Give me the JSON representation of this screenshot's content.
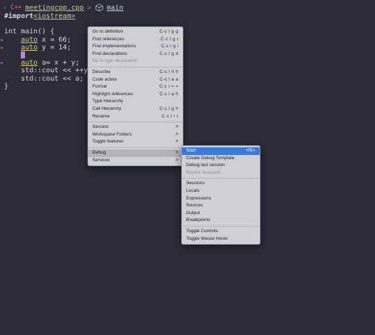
{
  "breadcrumb": {
    "file_label": "meetingcpp.cpp",
    "symbol_label": "main"
  },
  "code": {
    "line1_directive": "#import",
    "line1_header": "<iostream>",
    "line3": "int main() {",
    "line4_kw": "auto",
    "line4_rest": " x = 66;",
    "line5_kw": "auto",
    "line5_rest": " y = 14;",
    "line7_kw": "auto",
    "line7_rest": " a= x + y;",
    "line8": "std::cout << ++y +",
    "line9": "std::cout << a;",
    "line10": "}"
  },
  "context_menu": {
    "items": [
      {
        "label": "Go to definition",
        "shortcut": "C-c l g g"
      },
      {
        "label": "Find references",
        "shortcut": "C-c l g r"
      },
      {
        "label": "Find implementations",
        "shortcut": "C-c l g i"
      },
      {
        "label": "Find declarations",
        "shortcut": "C-c l g d"
      },
      {
        "label": "Go to type declaration",
        "shortcut": ""
      },
      {
        "label": "Describe",
        "shortcut": "C-c l h h"
      },
      {
        "label": "Code action",
        "shortcut": "C-c l a a"
      },
      {
        "label": "Format",
        "shortcut": "C-c l = ="
      },
      {
        "label": "Highlight references",
        "shortcut": "C-c l a h"
      },
      {
        "label": "Type Hierarchy",
        "shortcut": ""
      },
      {
        "label": "Call Hierarchy",
        "shortcut": "C-c l g h"
      },
      {
        "label": "Rename",
        "shortcut": "C-c l r r"
      },
      {
        "label": "Session",
        "shortcut": ">"
      },
      {
        "label": "Workspace Folders",
        "shortcut": ">"
      },
      {
        "label": "Toggle features",
        "shortcut": ">"
      },
      {
        "label": "Debug",
        "shortcut": ">"
      },
      {
        "label": "Services",
        "shortcut": ">"
      }
    ]
  },
  "debug_submenu": {
    "items": [
      {
        "label": "Start",
        "shortcut": "<f5>"
      },
      {
        "label": "Create Debug Template",
        "shortcut": ""
      },
      {
        "label": "Debug last session",
        "shortcut": ""
      },
      {
        "label": "Recent Sessions",
        "shortcut": ""
      },
      {
        "label": "Sessions",
        "shortcut": ""
      },
      {
        "label": "Locals",
        "shortcut": ""
      },
      {
        "label": "Expressions",
        "shortcut": ""
      },
      {
        "label": "Sources",
        "shortcut": ""
      },
      {
        "label": "Output",
        "shortcut": ""
      },
      {
        "label": "Breakpoints",
        "shortcut": ""
      },
      {
        "label": "Toggle Controls",
        "shortcut": ""
      },
      {
        "label": "Toggle Mouse Hover",
        "shortcut": ""
      }
    ]
  },
  "colors": {
    "background": "#2b2c38",
    "menu_background": "#cfd0d4",
    "active_item": "#3b78d8",
    "keyword": "#d6d07a"
  }
}
